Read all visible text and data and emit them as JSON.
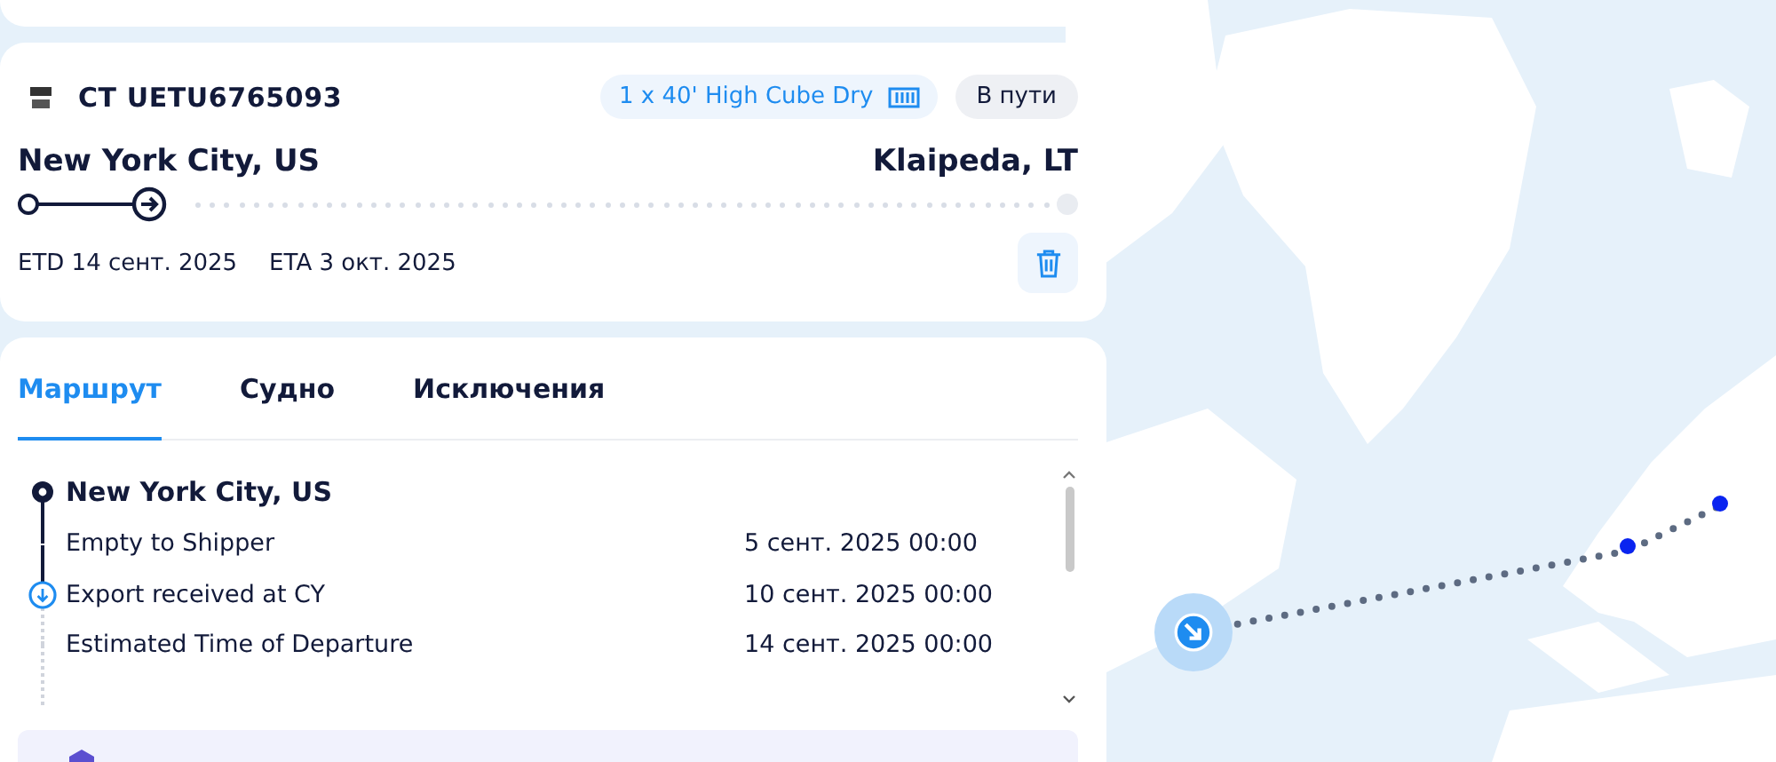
{
  "shipment": {
    "carrier_code": "CT",
    "container": "UETU6765093",
    "equipment": "1 x 40' High Cube Dry",
    "status": "В пути",
    "origin": "New York City, US",
    "destination": "Klaipeda, LT",
    "level": 0.14,
    "etd": "ETD 14 сент. 2025",
    "eta": "ETA 3 окт. 2025"
  },
  "tabs": [
    {
      "label": "Маршрут",
      "selected": true
    },
    {
      "label": "Судно",
      "selected": false
    },
    {
      "label": "Исключения",
      "selected": false
    }
  ],
  "route": {
    "location": "New York City, US",
    "events": [
      {
        "label": "Empty to Shipper",
        "time": "5 сент. 2025 00:00",
        "current": false,
        "completed": true
      },
      {
        "label": "Export received at CY",
        "time": "10 сент. 2025 00:00",
        "current": true,
        "completed": true
      },
      {
        "label": "Estimated Time of Departure",
        "time": "14 сент. 2025 00:00",
        "current": false,
        "completed": false
      }
    ]
  }
}
